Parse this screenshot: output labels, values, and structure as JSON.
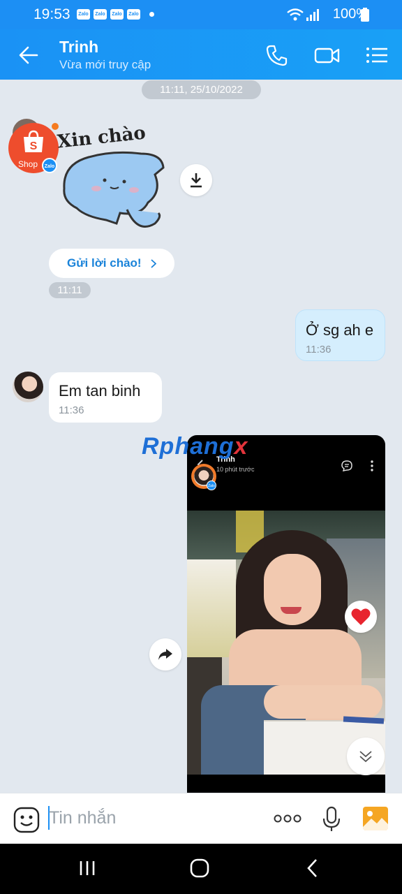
{
  "status_bar": {
    "time": "19:53",
    "notification_icons": [
      "Zalo",
      "Zalo",
      "Zalo",
      "Zalo"
    ],
    "battery": "100%"
  },
  "header": {
    "contact_name": "Trinh",
    "presence": "Vừa mới truy cập",
    "icons": [
      "back-arrow-icon",
      "phone-icon",
      "video-call-icon",
      "menu-list-icon"
    ]
  },
  "chat": {
    "date_separator": "11:11, 25/10/2022",
    "sticker_text": "Xin chào",
    "shop_avatar": {
      "line1": "Shop",
      "badge": "Zalo"
    },
    "greeting_button": "Gửi lời chào!",
    "greeting_time": "11:11",
    "messages": [
      {
        "direction": "out",
        "text": "Ở sg ah e",
        "time": "11:36"
      },
      {
        "direction": "in",
        "text": "Em tan binh",
        "time": "11:36"
      }
    ],
    "watermark": {
      "part1": "Rphang",
      "part2": "x"
    },
    "story": {
      "name": "Trinh",
      "posted": "10 phút trước",
      "badge": "Zalo"
    }
  },
  "input_bar": {
    "placeholder": "Tin nhắn"
  },
  "colors": {
    "brand_blue": "#1a92f5",
    "chat_background": "#e2e8ef",
    "outgoing_bubble": "#d5eefd",
    "heart_red": "#e8252f",
    "shopee_orange": "#ee4d2d"
  }
}
